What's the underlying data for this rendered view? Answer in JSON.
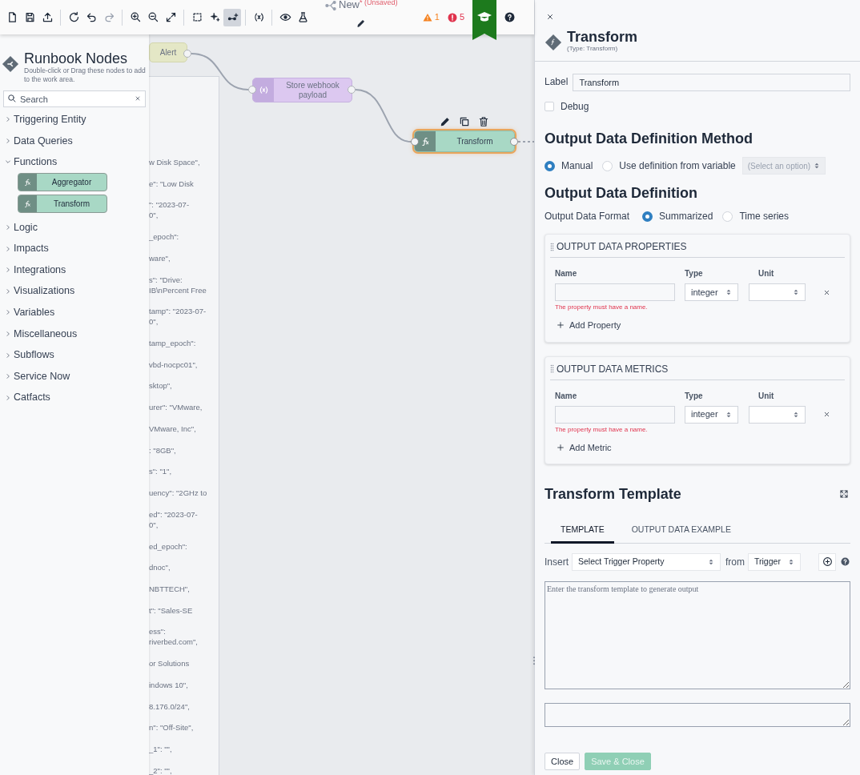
{
  "toolbar": {
    "tools": [
      [
        {
          "active": false,
          "disabled": false
        },
        {
          "active": false,
          "disabled": false
        },
        {
          "active": false,
          "disabled": false
        }
      ],
      [
        {
          "active": false,
          "disabled": false
        },
        {
          "active": false,
          "disabled": false
        },
        {
          "active": false,
          "disabled": true
        }
      ],
      [
        {
          "active": false,
          "disabled": false
        },
        {
          "active": false,
          "disabled": false
        },
        {
          "active": false,
          "disabled": false
        }
      ],
      [
        {
          "active": false,
          "disabled": false
        },
        {
          "active": false,
          "disabled": false
        },
        {
          "active": true,
          "disabled": false
        }
      ],
      [
        {
          "active": false,
          "disabled": false
        }
      ],
      [
        {
          "active": false,
          "disabled": false
        },
        {
          "active": false,
          "disabled": false
        }
      ]
    ],
    "flow": {
      "title": "New",
      "modified_mark": "*",
      "status": "(Unsaved)"
    },
    "warnings": "1",
    "errors": "5"
  },
  "sidebar": {
    "title": "Runbook Nodes",
    "subtitle": "Double-click or Drag these nodes to add to the work area.",
    "search": {
      "placeholder": "Search"
    },
    "categories": [
      {
        "label": "Triggering Entity",
        "expanded": false
      },
      {
        "label": "Data Queries",
        "expanded": false
      },
      {
        "label": "Functions",
        "expanded": true,
        "children": [
          {
            "label": "Aggregator"
          },
          {
            "label": "Transform"
          }
        ]
      },
      {
        "label": "Logic",
        "expanded": false
      },
      {
        "label": "Impacts",
        "expanded": false
      },
      {
        "label": "Integrations",
        "expanded": false
      },
      {
        "label": "Visualizations",
        "expanded": false
      },
      {
        "label": "Variables",
        "expanded": false
      },
      {
        "label": "Miscellaneous",
        "expanded": false
      },
      {
        "label": "Subflows",
        "expanded": false
      },
      {
        "label": "Service Now",
        "expanded": false
      },
      {
        "label": "Catfacts",
        "expanded": false
      }
    ]
  },
  "canvas": {
    "nodes": [
      {
        "kind": "trigger",
        "label": "Alert",
        "selected": false
      },
      {
        "kind": "variable",
        "label": "Store webhook payload",
        "selected": false
      },
      {
        "kind": "function",
        "label": "Transform",
        "selected": true
      }
    ],
    "payload_preview": [
      [
        "w Disk Space\","
      ],
      [
        "e\": \"Low Disk"
      ],
      [
        "\": \"2023-07-",
        "0\","
      ],
      [
        "_epoch\":"
      ],
      [
        "ware\","
      ],
      [
        "s\": \"Drive:",
        "IB\\nPercent Free"
      ],
      [
        "tamp\": \"2023-07-",
        "0\","
      ],
      [
        "tamp_epoch\":"
      ],
      [
        "vbd-nocpc01\","
      ],
      [
        "sktop\","
      ],
      [
        "urer\": \"VMware,"
      ],
      [
        "VMware, Inc\","
      ],
      [
        ": \"8GB\","
      ],
      [
        "s\": \"1\","
      ],
      [
        "uency\": \"2GHz to"
      ],
      [
        "ed\": \"2023-07-",
        "0\","
      ],
      [
        "ed_epoch\":"
      ],
      [
        "dnoc\","
      ],
      [
        "NBTTECH\","
      ],
      [
        "t\": \"Sales-SE"
      ],
      [
        "ess\":",
        "riverbed.com\","
      ],
      [
        "or Solutions"
      ],
      [
        "indows 10\","
      ],
      [
        "8.176.0/24\","
      ],
      [
        "n\": \"Off-Site\","
      ],
      [
        "_1\": \"\","
      ],
      [
        "_2\": \"\","
      ]
    ]
  },
  "panel": {
    "title": "Transform",
    "type_label": "(Type: Transform)",
    "label_field": {
      "label": "Label",
      "value": "Transform"
    },
    "debug": {
      "label": "Debug",
      "checked": false
    },
    "method": {
      "heading": "Output Data Definition Method",
      "options": [
        {
          "label": "Manual",
          "selected": true
        },
        {
          "label": "Use definition from variable",
          "selected": false
        }
      ],
      "variable_select": {
        "placeholder": "(Select an option)",
        "disabled": true
      }
    },
    "definition": {
      "heading": "Output Data Definition",
      "format_label": "Output Data Format",
      "formats": [
        {
          "label": "Summarized",
          "selected": true
        },
        {
          "label": "Time series",
          "selected": false
        }
      ]
    },
    "sections": [
      {
        "title": "OUTPUT DATA PROPERTIES",
        "columns": [
          "Name",
          "Type",
          "Unit"
        ],
        "rows": [
          {
            "type": "integer",
            "error": "The property must have a name."
          }
        ],
        "add_label": "Add Property"
      },
      {
        "title": "OUTPUT DATA METRICS",
        "columns": [
          "Name",
          "Type",
          "Unit"
        ],
        "rows": [
          {
            "type": "integer",
            "error": "The property must have a name."
          }
        ],
        "add_label": "Add Metric"
      }
    ],
    "template": {
      "heading": "Transform Template",
      "tabs": [
        {
          "label": "TEMPLATE",
          "selected": true
        },
        {
          "label": "OUTPUT DATA EXAMPLE",
          "selected": false
        }
      ],
      "insert_label": "Insert",
      "property_select": "Select Trigger Property",
      "from_label": "from",
      "source_select": "Trigger",
      "editor": {
        "placeholder": "Enter the transform template to generate output"
      }
    },
    "buttons": [
      {
        "label": "Close",
        "kind": "secondary",
        "disabled": false
      },
      {
        "label": "Save & Close",
        "kind": "primary",
        "disabled": true
      }
    ]
  }
}
